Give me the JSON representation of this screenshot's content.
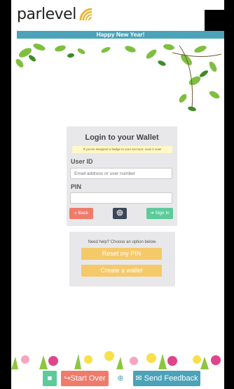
{
  "brand": {
    "name": "parlevel"
  },
  "banner": {
    "text": "Happy New Year!"
  },
  "login": {
    "title": "Login to your Wallet",
    "badge_note": "If you've assigned a badge to your account, scan it now!",
    "user_id_label": "User ID",
    "user_id_placeholder": "Email address or user number",
    "pin_label": "PIN",
    "pin_placeholder": "",
    "back_label": "Back",
    "sign_in_label": "Sign In"
  },
  "help": {
    "text": "Need help? Choose an option below.",
    "reset_label": "Reset my PIN",
    "create_label": "Create a wallet"
  },
  "bottom": {
    "start_over_label": "Start Over",
    "send_feedback_label": "Send Feedback"
  },
  "colors": {
    "teal_banner": "#4aa3b8",
    "back_button": "#f07b6b",
    "sign_in_button": "#5ccb9a",
    "fingerprint_button": "#3b4656",
    "help_button": "#f5c96a",
    "cart_button": "#5ccb9a",
    "start_over_button": "#f07b6b",
    "feedback_button": "#4aa3b8"
  },
  "icons": [
    "wifi-logo-icon",
    "back-arrow-icon",
    "fingerprint-icon",
    "sign-in-icon",
    "truck-icon",
    "start-over-icon",
    "globe-icon",
    "envelope-icon"
  ]
}
